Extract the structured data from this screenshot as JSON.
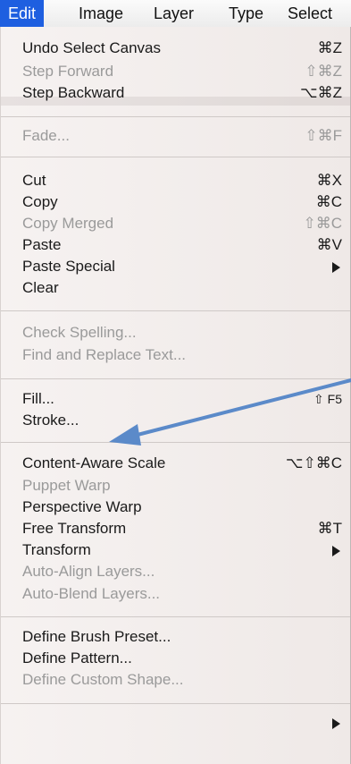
{
  "menubar": [
    "Edit",
    "Image",
    "Layer",
    "Type",
    "Select"
  ],
  "menu": {
    "undo": {
      "label": "Undo Select Canvas",
      "shortcut": "⌘Z"
    },
    "step_forward": {
      "label": "Step Forward",
      "shortcut": "⇧⌘Z"
    },
    "step_backward": {
      "label": "Step Backward",
      "shortcut": "⌥⌘Z"
    },
    "fade": {
      "label": "Fade...",
      "shortcut": "⇧⌘F"
    },
    "cut": {
      "label": "Cut",
      "shortcut": "⌘X"
    },
    "copy": {
      "label": "Copy",
      "shortcut": "⌘C"
    },
    "copy_merged": {
      "label": "Copy Merged",
      "shortcut": "⇧⌘C"
    },
    "paste": {
      "label": "Paste",
      "shortcut": "⌘V"
    },
    "paste_special": {
      "label": "Paste Special"
    },
    "clear": {
      "label": "Clear"
    },
    "check_spelling": {
      "label": "Check Spelling..."
    },
    "find_replace": {
      "label": "Find and Replace Text..."
    },
    "fill": {
      "label": "Fill...",
      "shortcut": "⇧ F5"
    },
    "stroke": {
      "label": "Stroke..."
    },
    "content_aware_scale": {
      "label": "Content-Aware Scale",
      "shortcut": "⌥⇧⌘C"
    },
    "puppet_warp": {
      "label": "Puppet Warp"
    },
    "perspective_warp": {
      "label": "Perspective Warp"
    },
    "free_transform": {
      "label": "Free Transform",
      "shortcut": "⌘T"
    },
    "transform": {
      "label": "Transform"
    },
    "auto_align": {
      "label": "Auto-Align Layers..."
    },
    "auto_blend": {
      "label": "Auto-Blend Layers..."
    },
    "define_brush": {
      "label": "Define Brush Preset..."
    },
    "define_pattern": {
      "label": "Define Pattern..."
    },
    "define_shape": {
      "label": "Define Custom Shape..."
    }
  },
  "colors": {
    "accent": "#1e5fe0",
    "annotation_arrow": "#5b8ac9"
  }
}
